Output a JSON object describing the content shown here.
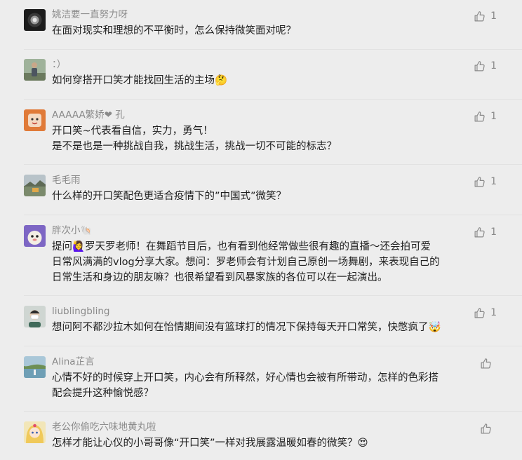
{
  "comments": [
    {
      "user": "姚洁要一直努力呀",
      "lines": [
        "在面对现实和理想的不平衡时，怎么保持微笑面对呢？"
      ],
      "likes": "1",
      "avatar_icon": "night-scene-avatar-icon"
    },
    {
      "user": "：）",
      "lines": [
        "如何穿搭开口笑才能找回生活的主场🤔"
      ],
      "likes": "1",
      "avatar_icon": "person-outdoor-avatar-icon"
    },
    {
      "user": "AAAAA繁娇❤ 孔",
      "lines": [
        "开口笑~代表看自信，实力，勇气！",
        "是不是也是一种挑战自我，挑战生活，挑战一切不可能的标志？"
      ],
      "likes": "1",
      "avatar_icon": "orange-cartoon-avatar-icon"
    },
    {
      "user": "毛毛雨",
      "lines": [
        "什么样的开口笑配色更适合疫情下的”中国式”微笑？"
      ],
      "likes": "1",
      "avatar_icon": "landscape-avatar-icon"
    },
    {
      "user": "胖次小🐚",
      "lines": [
        "提问🙋‍♀️罗天罗老师！在舞蹈节目后，也有看到他经常做些很有趣的直播～还会拍可爱",
        "日常风满满的vlog分享大家。想问：罗老师会有计划自己原创一场舞剧，来表现自己的",
        "日常生活和身边的朋友嘛？也很希望看到风暴家族的各位可以在一起演出。"
      ],
      "likes": "1",
      "avatar_icon": "purple-cartoon-avatar-icon"
    },
    {
      "user": "liublingbling",
      "lines": [
        "想问阿不都沙拉木如何在怡情期间没有篮球打的情况下保持每天开口常笑，快憋疯了🤯"
      ],
      "likes": "1",
      "avatar_icon": "masked-person-avatar-icon"
    },
    {
      "user": "Alina芷言",
      "lines": [
        "心情不好的时候穿上开口笑，内心会有所释然，好心情也会被有所带动，怎样的色彩搭",
        "配会提升这种愉悦感？"
      ],
      "likes": "",
      "avatar_icon": "lakeside-avatar-icon"
    },
    {
      "user": "老公你偷吃六味地黄丸啦",
      "lines": [
        "怎样才能让心仪的小哥哥像“开口笑”一样对我展露温暖如春的微笑？😍"
      ],
      "likes": "",
      "avatar_icon": "anime-girl-avatar-icon"
    }
  ]
}
